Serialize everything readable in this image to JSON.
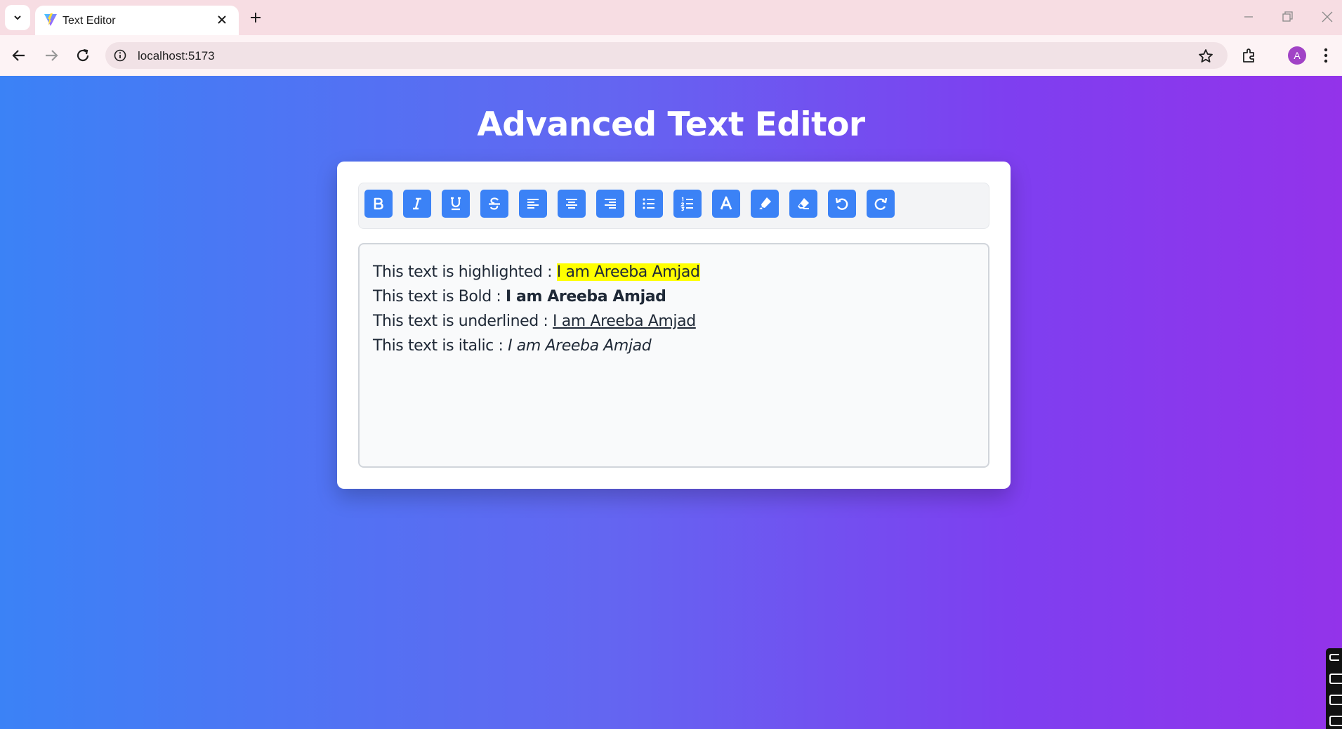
{
  "browser": {
    "tab_title": "Text Editor",
    "url": "localhost:5173",
    "avatar_letter": "A"
  },
  "app": {
    "title": "Advanced Text Editor",
    "toolbar_buttons": [
      {
        "name": "bold",
        "icon": "bold-icon"
      },
      {
        "name": "italic",
        "icon": "italic-icon"
      },
      {
        "name": "underline",
        "icon": "underline-icon"
      },
      {
        "name": "strikethrough",
        "icon": "strikethrough-icon"
      },
      {
        "name": "align-left",
        "icon": "align-left-icon"
      },
      {
        "name": "align-center",
        "icon": "align-center-icon"
      },
      {
        "name": "align-right",
        "icon": "align-right-icon"
      },
      {
        "name": "bullet-list",
        "icon": "bullet-list-icon"
      },
      {
        "name": "numbered-list",
        "icon": "numbered-list-icon"
      },
      {
        "name": "font-color",
        "icon": "font-color-icon"
      },
      {
        "name": "highlight",
        "icon": "highlighter-icon"
      },
      {
        "name": "clear-format",
        "icon": "eraser-icon"
      },
      {
        "name": "undo",
        "icon": "undo-icon"
      },
      {
        "name": "redo",
        "icon": "redo-icon"
      }
    ],
    "editor": {
      "lines": [
        {
          "prefix": "This text is highlighted : ",
          "styled": "I am Areeba Amjad",
          "style": "highlight"
        },
        {
          "prefix": "This text is Bold : ",
          "styled": "I am Areeba Amjad",
          "style": "bold"
        },
        {
          "prefix": "This text is underlined : ",
          "styled": "I am Areeba Amjad",
          "style": "underline"
        },
        {
          "prefix": "This text is italic : ",
          "styled": "I am Areeba Amjad",
          "style": "italic"
        }
      ]
    }
  },
  "colors": {
    "button_blue": "#3b82f6",
    "highlight_yellow": "#ffff00",
    "gradient_start": "#3b82f6",
    "gradient_end": "#9333ea"
  }
}
